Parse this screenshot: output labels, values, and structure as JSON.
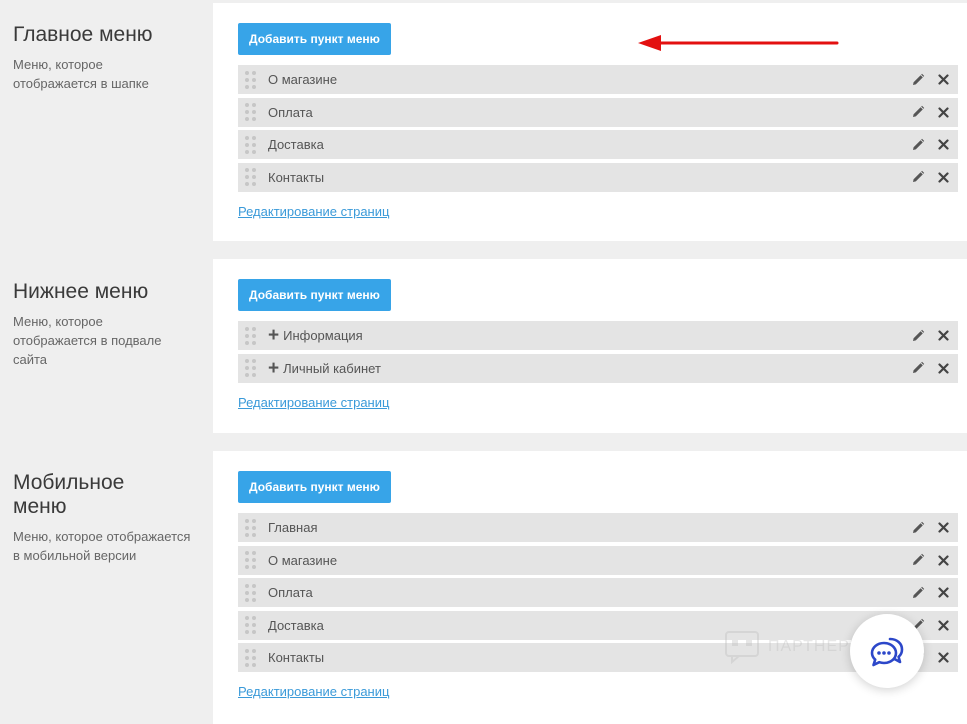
{
  "sections": [
    {
      "title": "Главное меню",
      "description": "Меню, которое отображается в шапке",
      "add_button": "Добавить пункт меню",
      "items": [
        {
          "label": "О магазине",
          "expandable": false
        },
        {
          "label": "Оплата",
          "expandable": false
        },
        {
          "label": "Доставка",
          "expandable": false
        },
        {
          "label": "Контакты",
          "expandable": false
        }
      ],
      "edit_link": "Редактирование страниц"
    },
    {
      "title": "Нижнее меню",
      "description": "Меню, которое отображается в подвале сайта",
      "add_button": "Добавить пункт меню",
      "items": [
        {
          "label": "Информация",
          "expandable": true
        },
        {
          "label": "Личный кабинет",
          "expandable": true
        }
      ],
      "edit_link": "Редактирование страниц"
    },
    {
      "title": "Мобильное меню",
      "description": "Меню, которое отображается в мобильной версии",
      "add_button": "Добавить пункт меню",
      "items": [
        {
          "label": "Главная",
          "expandable": false
        },
        {
          "label": "О магазине",
          "expandable": false
        },
        {
          "label": "Оплата",
          "expandable": false
        },
        {
          "label": "Доставка",
          "expandable": false
        },
        {
          "label": "Контакты",
          "expandable": false
        }
      ],
      "edit_link": "Редактирование страниц"
    }
  ],
  "watermark": "ПАРТНЕРКИН",
  "colors": {
    "accent": "#37a4e8",
    "link": "#3a9ad9",
    "arrow": "#e31010",
    "chat_icon": "#2c47c9"
  },
  "icons": {
    "edit": "pencil-icon",
    "remove": "close-icon",
    "drag": "drag-handle-icon",
    "expand": "plus-icon",
    "chat": "chat-bubbles-icon"
  }
}
